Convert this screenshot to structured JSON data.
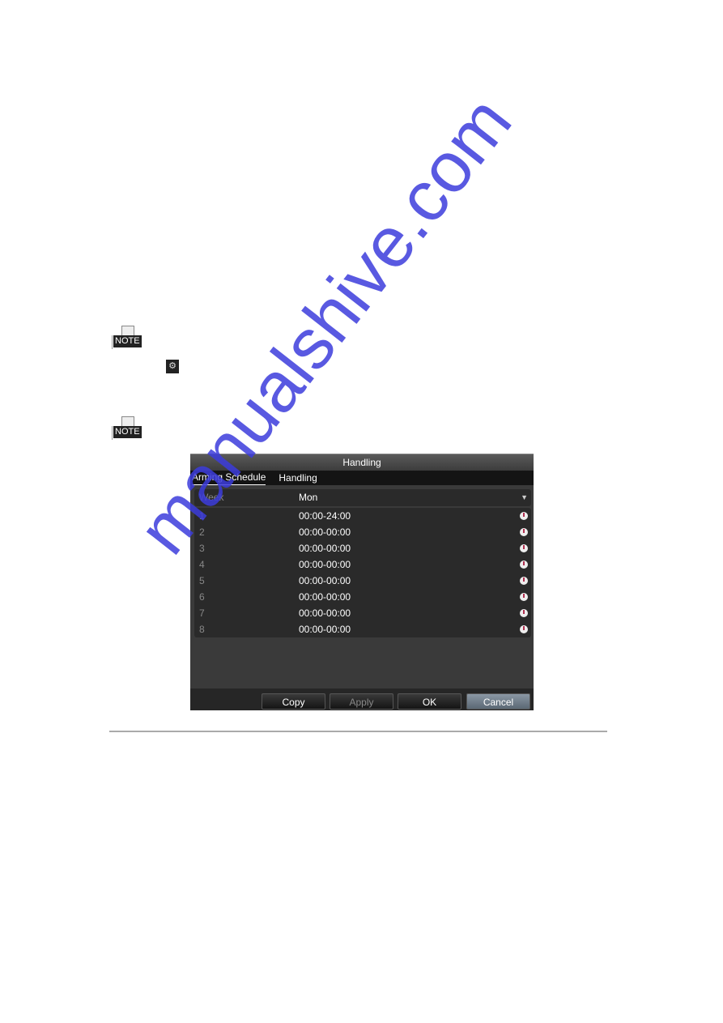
{
  "notes": [
    "NOTE",
    "NOTE"
  ],
  "dialog": {
    "title": "Handling",
    "tabs": [
      {
        "label": "Arming Schedule",
        "active": true
      },
      {
        "label": "Handling",
        "active": false
      }
    ],
    "week_label": "Week",
    "week_value": "Mon",
    "rows": [
      {
        "n": "1",
        "time": "00:00-24:00"
      },
      {
        "n": "2",
        "time": "00:00-00:00"
      },
      {
        "n": "3",
        "time": "00:00-00:00"
      },
      {
        "n": "4",
        "time": "00:00-00:00"
      },
      {
        "n": "5",
        "time": "00:00-00:00"
      },
      {
        "n": "6",
        "time": "00:00-00:00"
      },
      {
        "n": "7",
        "time": "00:00-00:00"
      },
      {
        "n": "8",
        "time": "00:00-00:00"
      }
    ],
    "buttons": {
      "copy": "Copy",
      "apply": "Apply",
      "ok": "OK",
      "cancel": "Cancel"
    }
  },
  "watermark": "manualshive.com"
}
